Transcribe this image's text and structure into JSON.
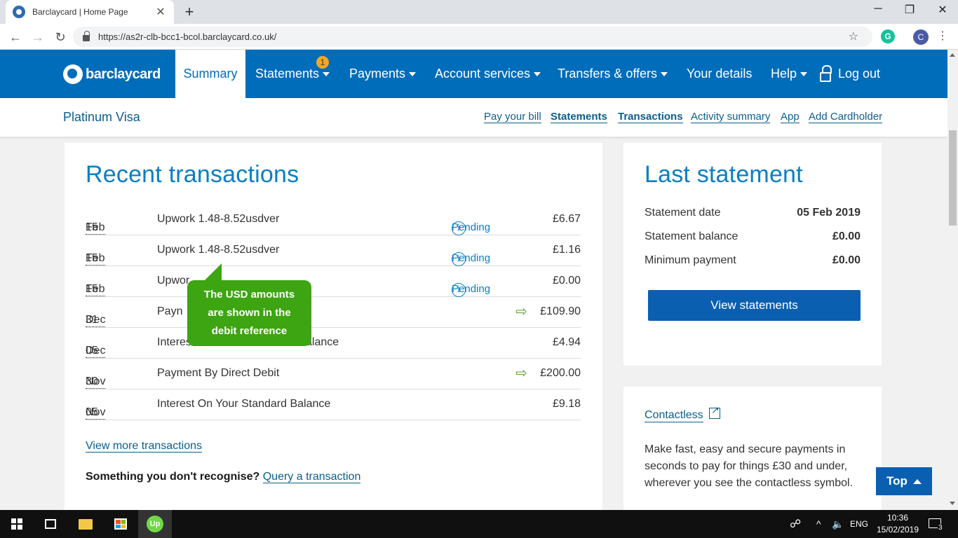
{
  "browser": {
    "tab_title": "Barclaycard | Home Page",
    "tab_close": "✕",
    "new_tab": "+",
    "url": "https://as2r-clb-bcc1-bcol.barclaycard.co.uk/",
    "controls": {
      "minimize": "─",
      "restore": "❐",
      "close": "✕"
    },
    "nav": {
      "back": "←",
      "forward": "→",
      "reload": "↻",
      "star": "☆"
    },
    "extension_letter": "G",
    "profile_letter": "C",
    "menu": "⋮"
  },
  "header": {
    "logo": "barclaycard",
    "nav": [
      {
        "label": "Summary"
      },
      {
        "label": "Statements",
        "badge": "1"
      },
      {
        "label": "Payments"
      },
      {
        "label": "Account services"
      },
      {
        "label": "Transfers & offers"
      },
      {
        "label": "Your details"
      },
      {
        "label": "Help"
      }
    ],
    "logout": "Log out"
  },
  "subbar": {
    "product": "Platinum Visa",
    "links": [
      "Pay your bill",
      "Statements",
      "Transactions",
      "Activity summary",
      "App",
      "Add Cardholder"
    ]
  },
  "transactions": {
    "title": "Recent transactions",
    "rows": [
      {
        "day": "15",
        "month": "Feb",
        "description": "Upwork 1.48-8.52usdver",
        "status": "Pending",
        "amount": "£6.67"
      },
      {
        "day": "15",
        "month": "Feb",
        "description": "Upwork 1.48-8.52usdver",
        "status": "Pending",
        "amount": "£1.16"
      },
      {
        "day": "15",
        "month": "Feb",
        "description": "Upwor",
        "status": "Pending",
        "amount": "£0.00"
      },
      {
        "day": "31",
        "month": "Dec",
        "description": "Payn",
        "status": "",
        "amount": "£109.90"
      },
      {
        "day": "05",
        "month": "Dec",
        "description": "Interes",
        "description_tail": "alance",
        "status": "",
        "amount": "£4.94"
      },
      {
        "day": "30",
        "month": "Nov",
        "description": "Payment By Direct Debit",
        "status": "",
        "amount": "£200.00"
      },
      {
        "day": "05",
        "month": "Nov",
        "description": "Interest On Your Standard Balance",
        "status": "",
        "amount": "£9.18"
      }
    ],
    "view_more": "View more transactions",
    "query_prompt": "Something you don't recognise?",
    "query_link": "Query a transaction",
    "info_glyph": "i",
    "arrow_glyph": "⇨"
  },
  "tooltip": {
    "lines": [
      "The USD amounts",
      "are shown in the",
      "debit reference"
    ]
  },
  "statement": {
    "title": "Last statement",
    "rows": [
      {
        "label": "Statement date",
        "value": "05 Feb 2019"
      },
      {
        "label": "Statement balance",
        "value": "£0.00"
      },
      {
        "label": "Minimum payment",
        "value": "£0.00"
      }
    ],
    "button": "View statements"
  },
  "contactless": {
    "link": "Contactless",
    "text": "Make fast, easy and secure payments in seconds to pay for things £30 and under, wherever you see the contactless symbol."
  },
  "top_button": "Top",
  "taskbar": {
    "upwork_label": "Up",
    "language": "ENG",
    "time": "10:36",
    "date": "15/02/2019",
    "notification_count": "3",
    "tray_glyphs": {
      "people": "☍",
      "chevron": "^",
      "volume": "🔈"
    }
  }
}
